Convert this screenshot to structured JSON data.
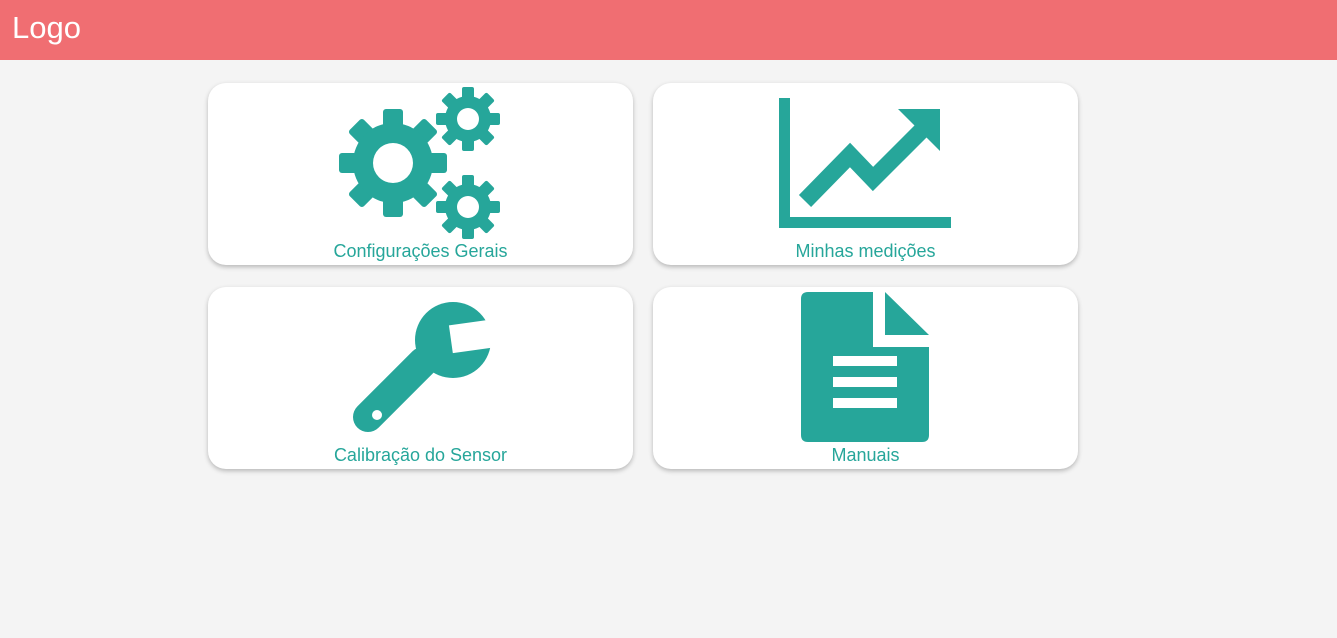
{
  "header": {
    "logo_text": "Logo",
    "background_color": "#f06e72"
  },
  "accent_color": "#26a69a",
  "menu": {
    "cards": [
      {
        "label": "Configurações Gerais",
        "icon": "gears-icon"
      },
      {
        "label": "Minhas medições",
        "icon": "line-chart-icon"
      },
      {
        "label": "Calibração do Sensor",
        "icon": "wrench-icon"
      },
      {
        "label": "Manuais",
        "icon": "document-icon"
      }
    ]
  }
}
